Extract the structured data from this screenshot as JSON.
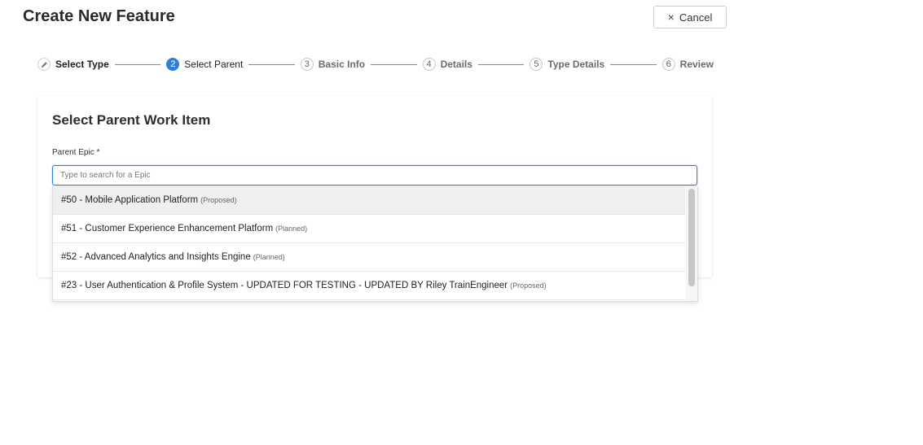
{
  "header": {
    "title": "Create New Feature",
    "cancel_label": "Cancel",
    "cancel_icon": "×"
  },
  "stepper": {
    "steps": [
      {
        "number": "✎",
        "label": "Select Type",
        "state": "completed",
        "icon": "pencil-icon"
      },
      {
        "number": "2",
        "label": "Select Parent",
        "state": "active"
      },
      {
        "number": "3",
        "label": "Basic Info",
        "state": "pending"
      },
      {
        "number": "4",
        "label": "Details",
        "state": "pending"
      },
      {
        "number": "5",
        "label": "Type Details",
        "state": "pending"
      },
      {
        "number": "6",
        "label": "Review",
        "state": "pending"
      }
    ]
  },
  "card": {
    "title": "Select Parent Work Item",
    "field_label": "Parent Epic *",
    "search_placeholder": "Type to search for a Epic",
    "search_value": ""
  },
  "dropdown": {
    "options": [
      {
        "label": "#50 - Mobile Application Platform",
        "status": "(Proposed)"
      },
      {
        "label": "#51 - Customer Experience Enhancement Platform",
        "status": "(Planned)"
      },
      {
        "label": "#52 - Advanced Analytics and Insights Engine",
        "status": "(Planned)"
      },
      {
        "label": "#23 - User Authentication & Profile System - UPDATED FOR TESTING - UPDATED BY Riley TrainEngineer",
        "status": "(Proposed)"
      }
    ]
  },
  "colors": {
    "accent": "#2f7fd8",
    "highlight_row": "#efefef"
  }
}
